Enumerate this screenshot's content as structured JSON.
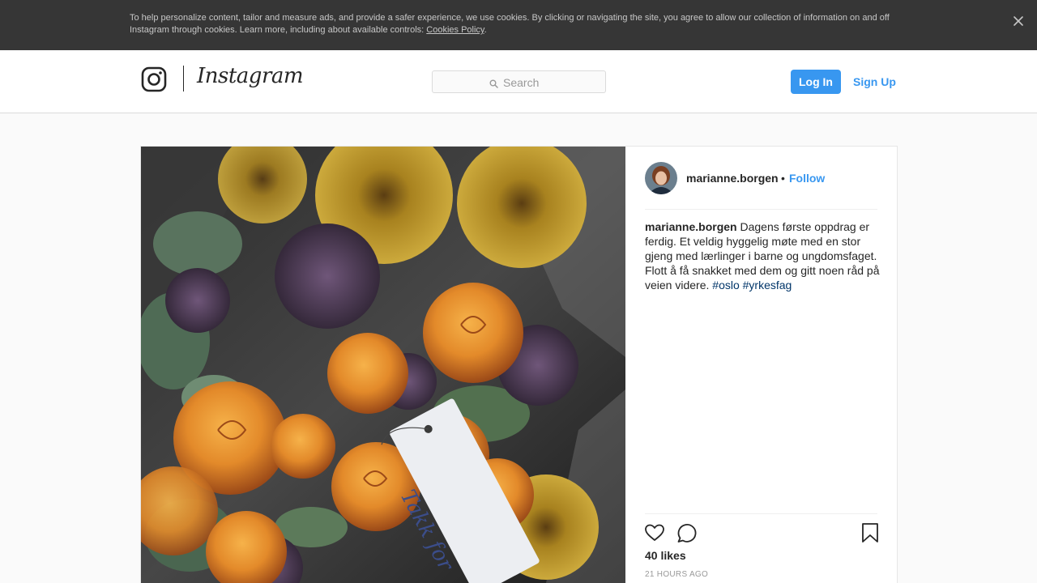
{
  "cookie_banner": {
    "text": "To help personalize content, tailor and measure ads, and provide a safer experience, we use cookies. By clicking or navigating the site, you agree to allow our collection of information on and off Instagram through cookies. Learn more, including about available controls: ",
    "link_label": "Cookies Policy",
    "link_suffix": ".",
    "close_icon": "close-icon"
  },
  "header": {
    "logo_icon": "instagram-camera-icon",
    "wordmark": "Instagram",
    "search": {
      "placeholder": "Search",
      "icon": "search-icon"
    },
    "login_label": "Log In",
    "signup_label": "Sign Up"
  },
  "post": {
    "image_alt": "Bouquet of orange roses, sunflowers and purple allium with a handwritten tag",
    "tag_text": "Takk for",
    "author": "marianne.borgen",
    "separator": "•",
    "follow_label": "Follow",
    "caption": {
      "author": "marianne.borgen",
      "text": " Dagens første oppdrag er ferdig. Et veldig hyggelig møte med en stor gjeng med lærlinger i barne og ungdomsfaget. Flott å få snakket med dem og gitt noen råd på veien videre. ",
      "hashtags": [
        "#oslo",
        "#yrkesfag"
      ]
    },
    "actions": {
      "like_icon": "heart-icon",
      "comment_icon": "comment-icon",
      "save_icon": "bookmark-icon"
    },
    "likes": "40 likes",
    "timestamp": "21 HOURS AGO"
  },
  "colors": {
    "accent": "#3897f0",
    "banner_bg": "#363636",
    "hashtag": "#003569",
    "page_bg": "#fafafa"
  }
}
